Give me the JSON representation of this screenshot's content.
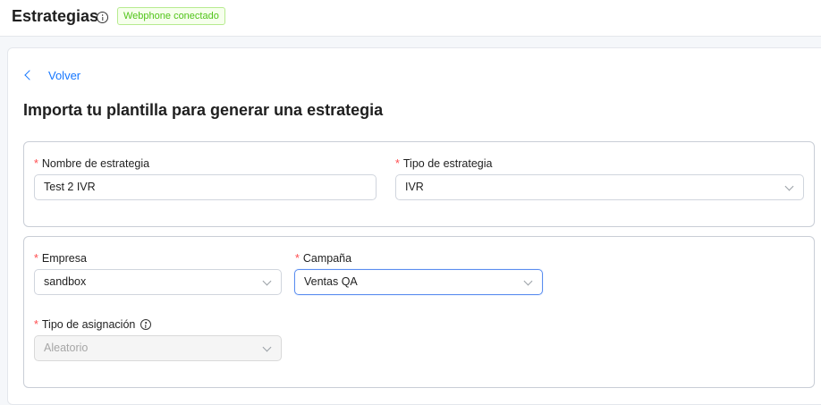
{
  "header": {
    "title": "Estrategias",
    "status_badge": "Webphone conectado"
  },
  "nav": {
    "back_label": "Volver"
  },
  "main": {
    "heading": "Importa tu plantilla para generar una estrategia",
    "required_mark": "*",
    "strategy_name": {
      "label": "Nombre de estrategia",
      "value": "Test 2 IVR"
    },
    "strategy_type": {
      "label": "Tipo de estrategia",
      "value": "IVR"
    },
    "company": {
      "label": "Empresa",
      "value": "sandbox"
    },
    "campaign": {
      "label": "Campaña",
      "value": "Ventas QA"
    },
    "assignment_type": {
      "label": "Tipo de asignación",
      "value": "Aleatorio"
    }
  },
  "colors": {
    "accent": "#1677ff",
    "success": "#52c41a",
    "required": "#ff4d4f"
  }
}
